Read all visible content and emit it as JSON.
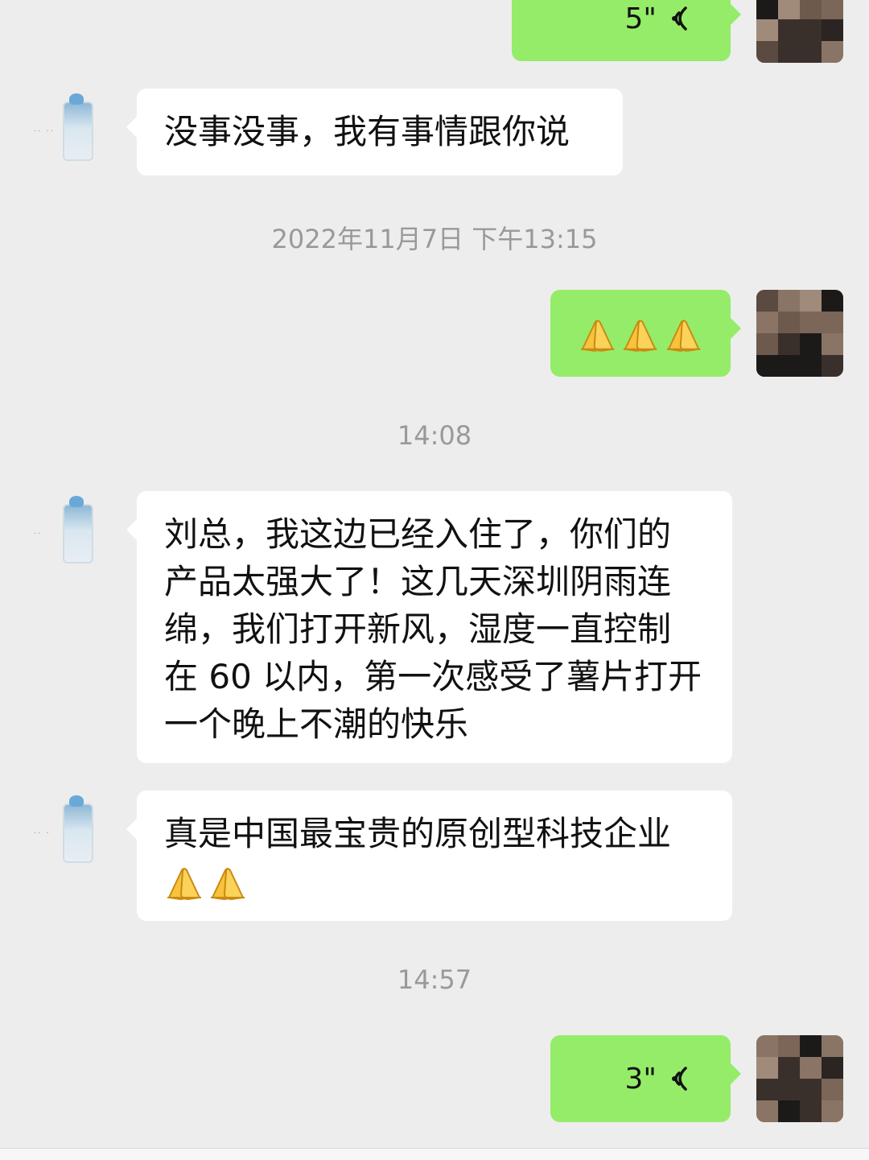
{
  "colors": {
    "background": "#ededed",
    "my_bubble": "#95ec69",
    "peer_bubble": "#ffffff",
    "timestamp_text": "#999999"
  },
  "messages": [
    {
      "sender": "me",
      "type": "voice",
      "duration": "5\""
    },
    {
      "sender": "peer",
      "type": "text",
      "text": "没事没事，我有事情跟你说"
    },
    {
      "type": "timestamp",
      "text": "2022年11月7日 下午13:15"
    },
    {
      "sender": "me",
      "type": "emoji",
      "emoji": "pray-emoji",
      "count": 3
    },
    {
      "type": "timestamp",
      "text": "14:08"
    },
    {
      "sender": "peer",
      "type": "text",
      "lines": [
        "刘总，我这边已经入住了，你们的",
        "产品太强大了！这几天深圳阴雨连",
        "绵，我们打开新风，湿度一直控制",
        "在 60 以内，第一次感受了薯片打开",
        "一个晚上不潮的快乐"
      ]
    },
    {
      "sender": "peer",
      "type": "text_emoji",
      "text": "真是中国最宝贵的原创型科技企业",
      "emoji": "pray-emoji",
      "count": 2
    },
    {
      "type": "timestamp",
      "text": "14:57"
    },
    {
      "sender": "me",
      "type": "voice",
      "duration": "3\""
    }
  ]
}
